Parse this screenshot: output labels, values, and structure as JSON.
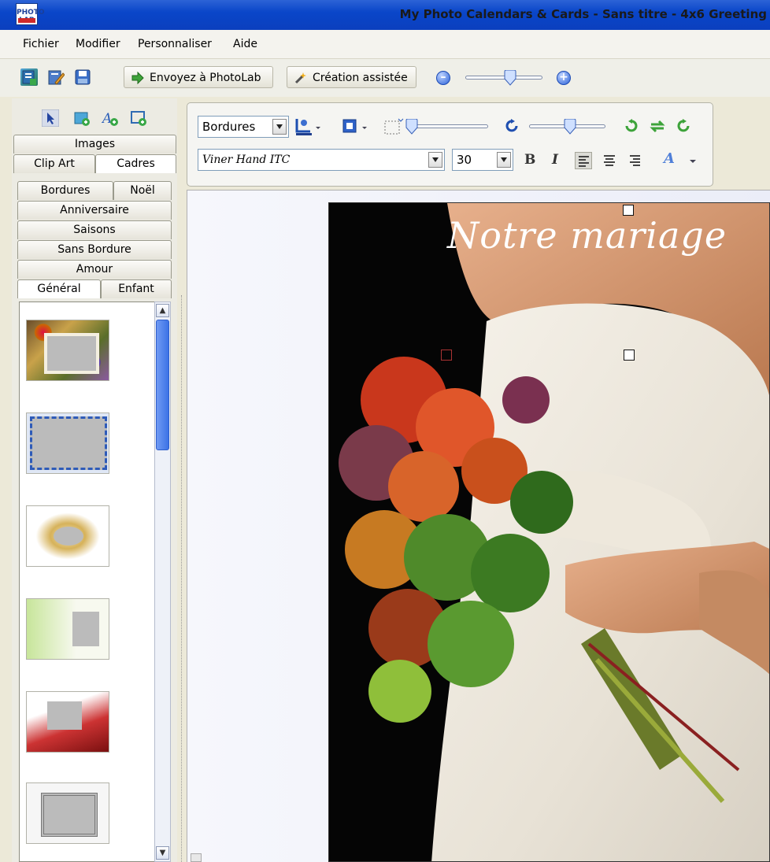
{
  "window": {
    "title": "My Photo Calendars & Cards - Sans titre - 4x6 Greeting",
    "app_icon_text": "PHOTO LAB"
  },
  "menu": {
    "items": [
      "Fichier",
      "Modifier",
      "Personnaliser",
      "Aide"
    ]
  },
  "toolbar": {
    "send_label": "Envoyez à PhotoLab",
    "wizard_label": "Création assistée",
    "zoom_level": 0.5
  },
  "text_panel": {
    "frame_type": "Bordures",
    "font_name": "Viner Hand ITC",
    "font_size": "30",
    "bold_label": "B",
    "italic_label": "I",
    "color_label": "A"
  },
  "sidebar": {
    "tabs_row1": [
      "Images"
    ],
    "tabs_row2": [
      "Clip Art",
      "Cadres"
    ],
    "active_tab": "Cadres",
    "category_tabs": {
      "bordures": "Bordures",
      "noel": "Noël",
      "anniversaire": "Anniversaire",
      "saisons": "Saisons",
      "sans_bordure": "Sans Bordure",
      "amour": "Amour",
      "general": "Général",
      "enfant": "Enfant"
    },
    "active_category": "Général",
    "frame_thumbnails": [
      "floral-frame",
      "blue-border-frame",
      "gold-burst-frame",
      "green-swirl-frame",
      "red-floral-frame",
      "ornate-silver-frame"
    ]
  },
  "card": {
    "title_text": "Notre mariage"
  },
  "colors": {
    "titlebar": "#0a46c9",
    "accent": "#2c62d8"
  }
}
